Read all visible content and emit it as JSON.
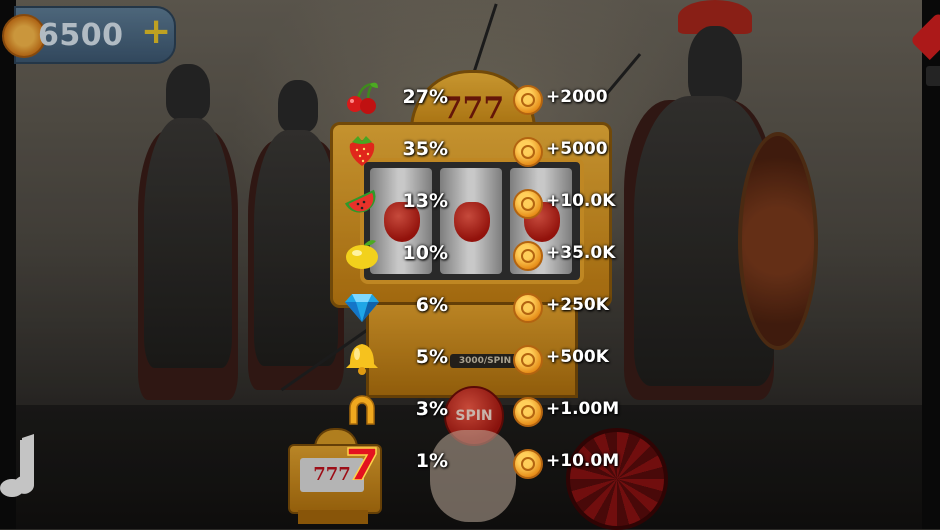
{
  "hud": {
    "coin_balance": "6500",
    "add_coins_label": "+"
  },
  "machine": {
    "title_label": "777",
    "spin_cost_label": "3000/SPIN",
    "spin_label": "SPIN",
    "mini_machine_label": "777"
  },
  "paytable": [
    {
      "symbol": "cherry-icon",
      "percent": "27%",
      "reward": "+2000"
    },
    {
      "symbol": "strawberry-icon",
      "percent": "35%",
      "reward": "+5000"
    },
    {
      "symbol": "watermelon-icon",
      "percent": "13%",
      "reward": "+10.0K"
    },
    {
      "symbol": "lemon-icon",
      "percent": "10%",
      "reward": "+35.0K"
    },
    {
      "symbol": "diamond-icon",
      "percent": "6%",
      "reward": "+250K"
    },
    {
      "symbol": "bell-icon",
      "percent": "5%",
      "reward": "+500K"
    },
    {
      "symbol": "horseshoe-icon",
      "percent": "3%",
      "reward": "+1.00M"
    },
    {
      "symbol": "seven-icon",
      "percent": "1%",
      "reward": "+10.0M"
    }
  ],
  "colors": {
    "gold": "#f0b33a",
    "coin": "#f7b84a",
    "spin_red": "#a81710",
    "text": "#ffffff"
  }
}
